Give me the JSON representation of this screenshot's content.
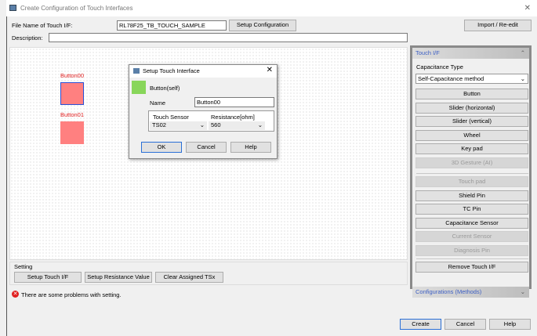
{
  "window": {
    "title": "Create Configuration of Touch Interfaces",
    "close": "✕"
  },
  "form": {
    "file_label": "File Name of Touch I/F:",
    "file_value": "RL78F25_TB_TOUCH_SAMPLE",
    "setup_config": "Setup Configuration",
    "import": "Import / Re-edit",
    "desc_label": "Description:",
    "desc_value": ""
  },
  "canvas": {
    "items": [
      {
        "label": "Button00",
        "selected": true
      },
      {
        "label": "Button01",
        "selected": false
      }
    ]
  },
  "dialog": {
    "title": "Setup Touch Interface",
    "type": "Button(self)",
    "type_color": "#88d65a",
    "name_label": "Name",
    "name_value": "Button00",
    "col1": "Touch Sensor",
    "col2": "Resistance[ohm]",
    "sensor": "TS02",
    "resistance": "560",
    "ok": "OK",
    "cancel": "Cancel",
    "help": "Help"
  },
  "panel": {
    "header": "Touch I/F",
    "cap_label": "Capacitance Type",
    "cap_value": "Self-Capacitance method",
    "buttons": [
      {
        "label": "Button"
      },
      {
        "label": "Slider (horizontal)"
      },
      {
        "label": "Slider (vertical)"
      },
      {
        "label": "Wheel"
      },
      {
        "label": "Key pad"
      },
      {
        "label": "3D Gesture (AI)",
        "disabled": true
      },
      {
        "label": "Touch pad",
        "disabled": true
      },
      {
        "label": "Shield Pin"
      },
      {
        "label": "TC Pin"
      },
      {
        "label": "Capacitance Sensor"
      },
      {
        "label": "Current Sensor",
        "disabled": true
      },
      {
        "label": "Diagnosis Pin",
        "disabled": true
      },
      {
        "label": "Remove Touch I/F"
      }
    ],
    "footer": "Configurations (Methods)"
  },
  "setting": {
    "title": "Setting",
    "b1": "Setup Touch I/F",
    "b2": "Setup Resistance Value",
    "b3": "Clear Assigned TSx"
  },
  "error": "There are some problems with setting.",
  "footer": {
    "create": "Create",
    "cancel": "Cancel",
    "help": "Help"
  }
}
